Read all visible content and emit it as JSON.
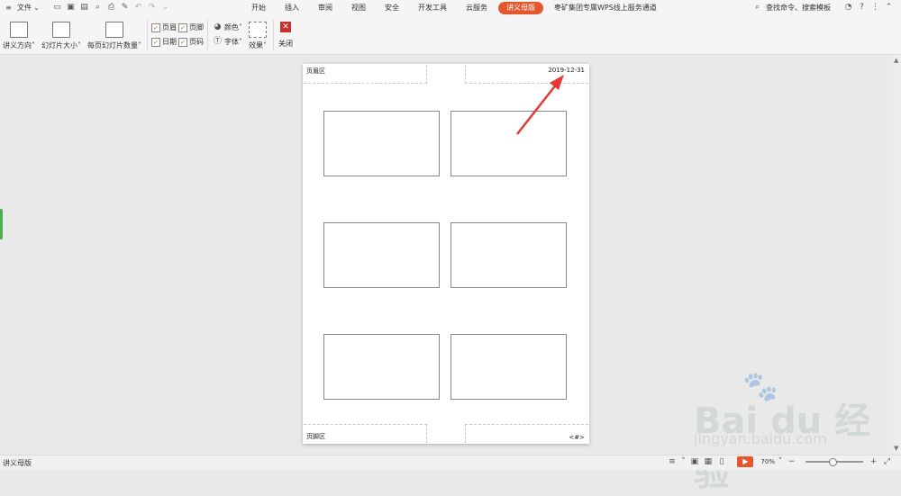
{
  "topbar": {
    "file_menu": "文件",
    "tabs": [
      "开始",
      "插入",
      "审阅",
      "视图",
      "安全",
      "开发工具",
      "云服务",
      "讲义母版",
      "枣矿集团专属WPS线上服务通道"
    ],
    "active_tab_index": 7,
    "search_text": "查找命令、搜索模板"
  },
  "ribbon": {
    "handout_orientation": "讲义方向",
    "slide_size": "幻灯片大小",
    "slides_per_page": "每页幻灯片数量",
    "header_chk": "页眉",
    "footer_chk": "页脚",
    "date_chk": "日期",
    "page_num_chk": "页码",
    "colors": "颜色",
    "fonts": "字体",
    "effects": "效果",
    "close": "关闭"
  },
  "page": {
    "header_label": "页眉区",
    "date_label": "2019-12-31",
    "footer_label": "页脚区",
    "page_num_label": "<#>"
  },
  "statusbar": {
    "mode": "讲义母版",
    "zoom": "70%"
  },
  "watermark": {
    "brand": "Bai du 经验",
    "url": "jingyan.baidu.com"
  },
  "colors": {
    "accent": "#e4572e",
    "close": "#c9302c",
    "arrow": "#e53935"
  }
}
